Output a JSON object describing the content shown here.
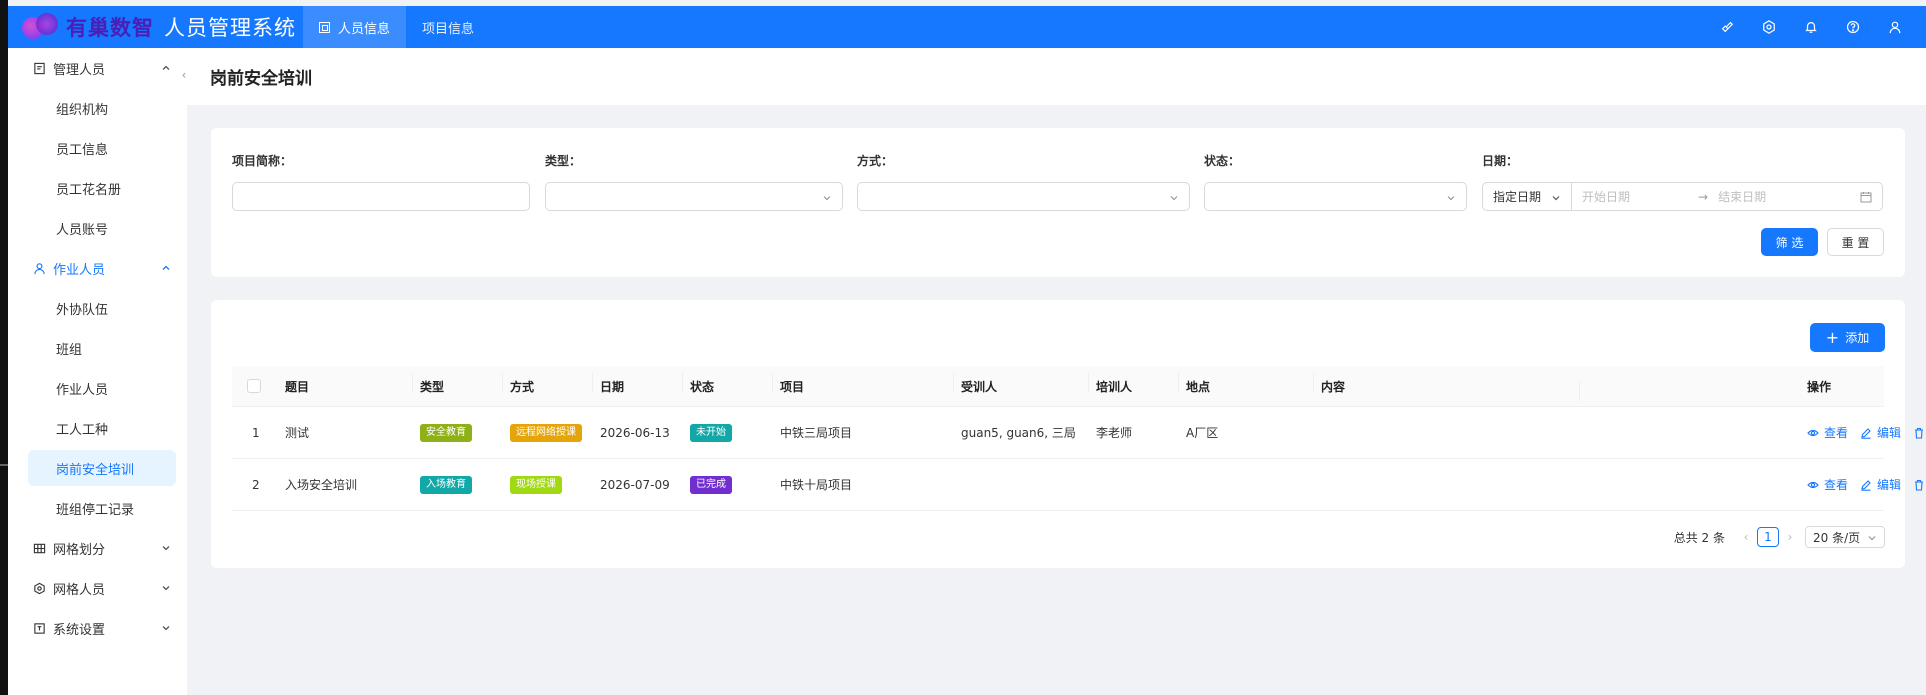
{
  "header": {
    "logo_text": "有巢数智",
    "app_title": "人员管理系统",
    "nav": [
      {
        "label": "人员信息",
        "active": true
      },
      {
        "label": "项目信息",
        "active": false
      }
    ],
    "actions": [
      "brush-icon",
      "settings-icon",
      "bell-icon",
      "help-icon",
      "user-icon"
    ]
  },
  "sidebar": {
    "groups": [
      {
        "label": "管理人员",
        "icon": "manager-icon",
        "expanded": true,
        "items": [
          "组织机构",
          "员工信息",
          "员工花名册",
          "人员账号"
        ]
      },
      {
        "label": "作业人员",
        "icon": "worker-icon",
        "expanded": true,
        "items": [
          "外协队伍",
          "班组",
          "作业人员",
          "工人工种",
          "岗前安全培训",
          "班组停工记录"
        ]
      },
      {
        "label": "网格划分",
        "icon": "grid-icon",
        "expanded": false,
        "items": []
      },
      {
        "label": "网格人员",
        "icon": "grid-people-icon",
        "expanded": false,
        "items": []
      },
      {
        "label": "系统设置",
        "icon": "system-icon",
        "expanded": false,
        "items": []
      }
    ],
    "selected_item": "岗前安全培训"
  },
  "page": {
    "title": "岗前安全培训"
  },
  "filters": {
    "project_label": "项目简称：",
    "type_label": "类型：",
    "mode_label": "方式：",
    "status_label": "状态：",
    "date_label": "日期：",
    "date_type_value": "指定日期",
    "date_start_placeholder": "开始日期",
    "date_end_placeholder": "结束日期",
    "date_arrow": "→",
    "filter_button": "筛 选",
    "reset_button": "重 置"
  },
  "table": {
    "add_button": "添加",
    "columns": [
      "题目",
      "类型",
      "方式",
      "日期",
      "状态",
      "项目",
      "受训人",
      "培训人",
      "地点",
      "内容",
      "操作"
    ],
    "rows": [
      {
        "index": "1",
        "topic": "测试",
        "type": "安全教育",
        "type_color": "#8fb117",
        "mode": "远程网络授课",
        "mode_color": "#e5a50a",
        "date": "2026-06-13",
        "status": "未开始",
        "status_color": "#13a8a8",
        "project": "中铁三局项目",
        "trainees": "guan5, guan6, 三局",
        "trainer": "李老师",
        "location": "A厂区",
        "content": ""
      },
      {
        "index": "2",
        "topic": "入场安全培训",
        "type": "入场教育",
        "type_color": "#13a8a8",
        "mode": "现场授课",
        "mode_color": "#a0d911",
        "date": "2026-07-09",
        "status": "已完成",
        "status_color": "#722ed1",
        "project": "中铁十局项目",
        "trainees": "",
        "trainer": "",
        "location": "",
        "content": ""
      }
    ],
    "ops": {
      "view": "查看",
      "edit": "编辑",
      "delete": "删除"
    },
    "pager": {
      "total": "总共 2 条",
      "current": "1",
      "page_size": "20 条/页"
    }
  }
}
